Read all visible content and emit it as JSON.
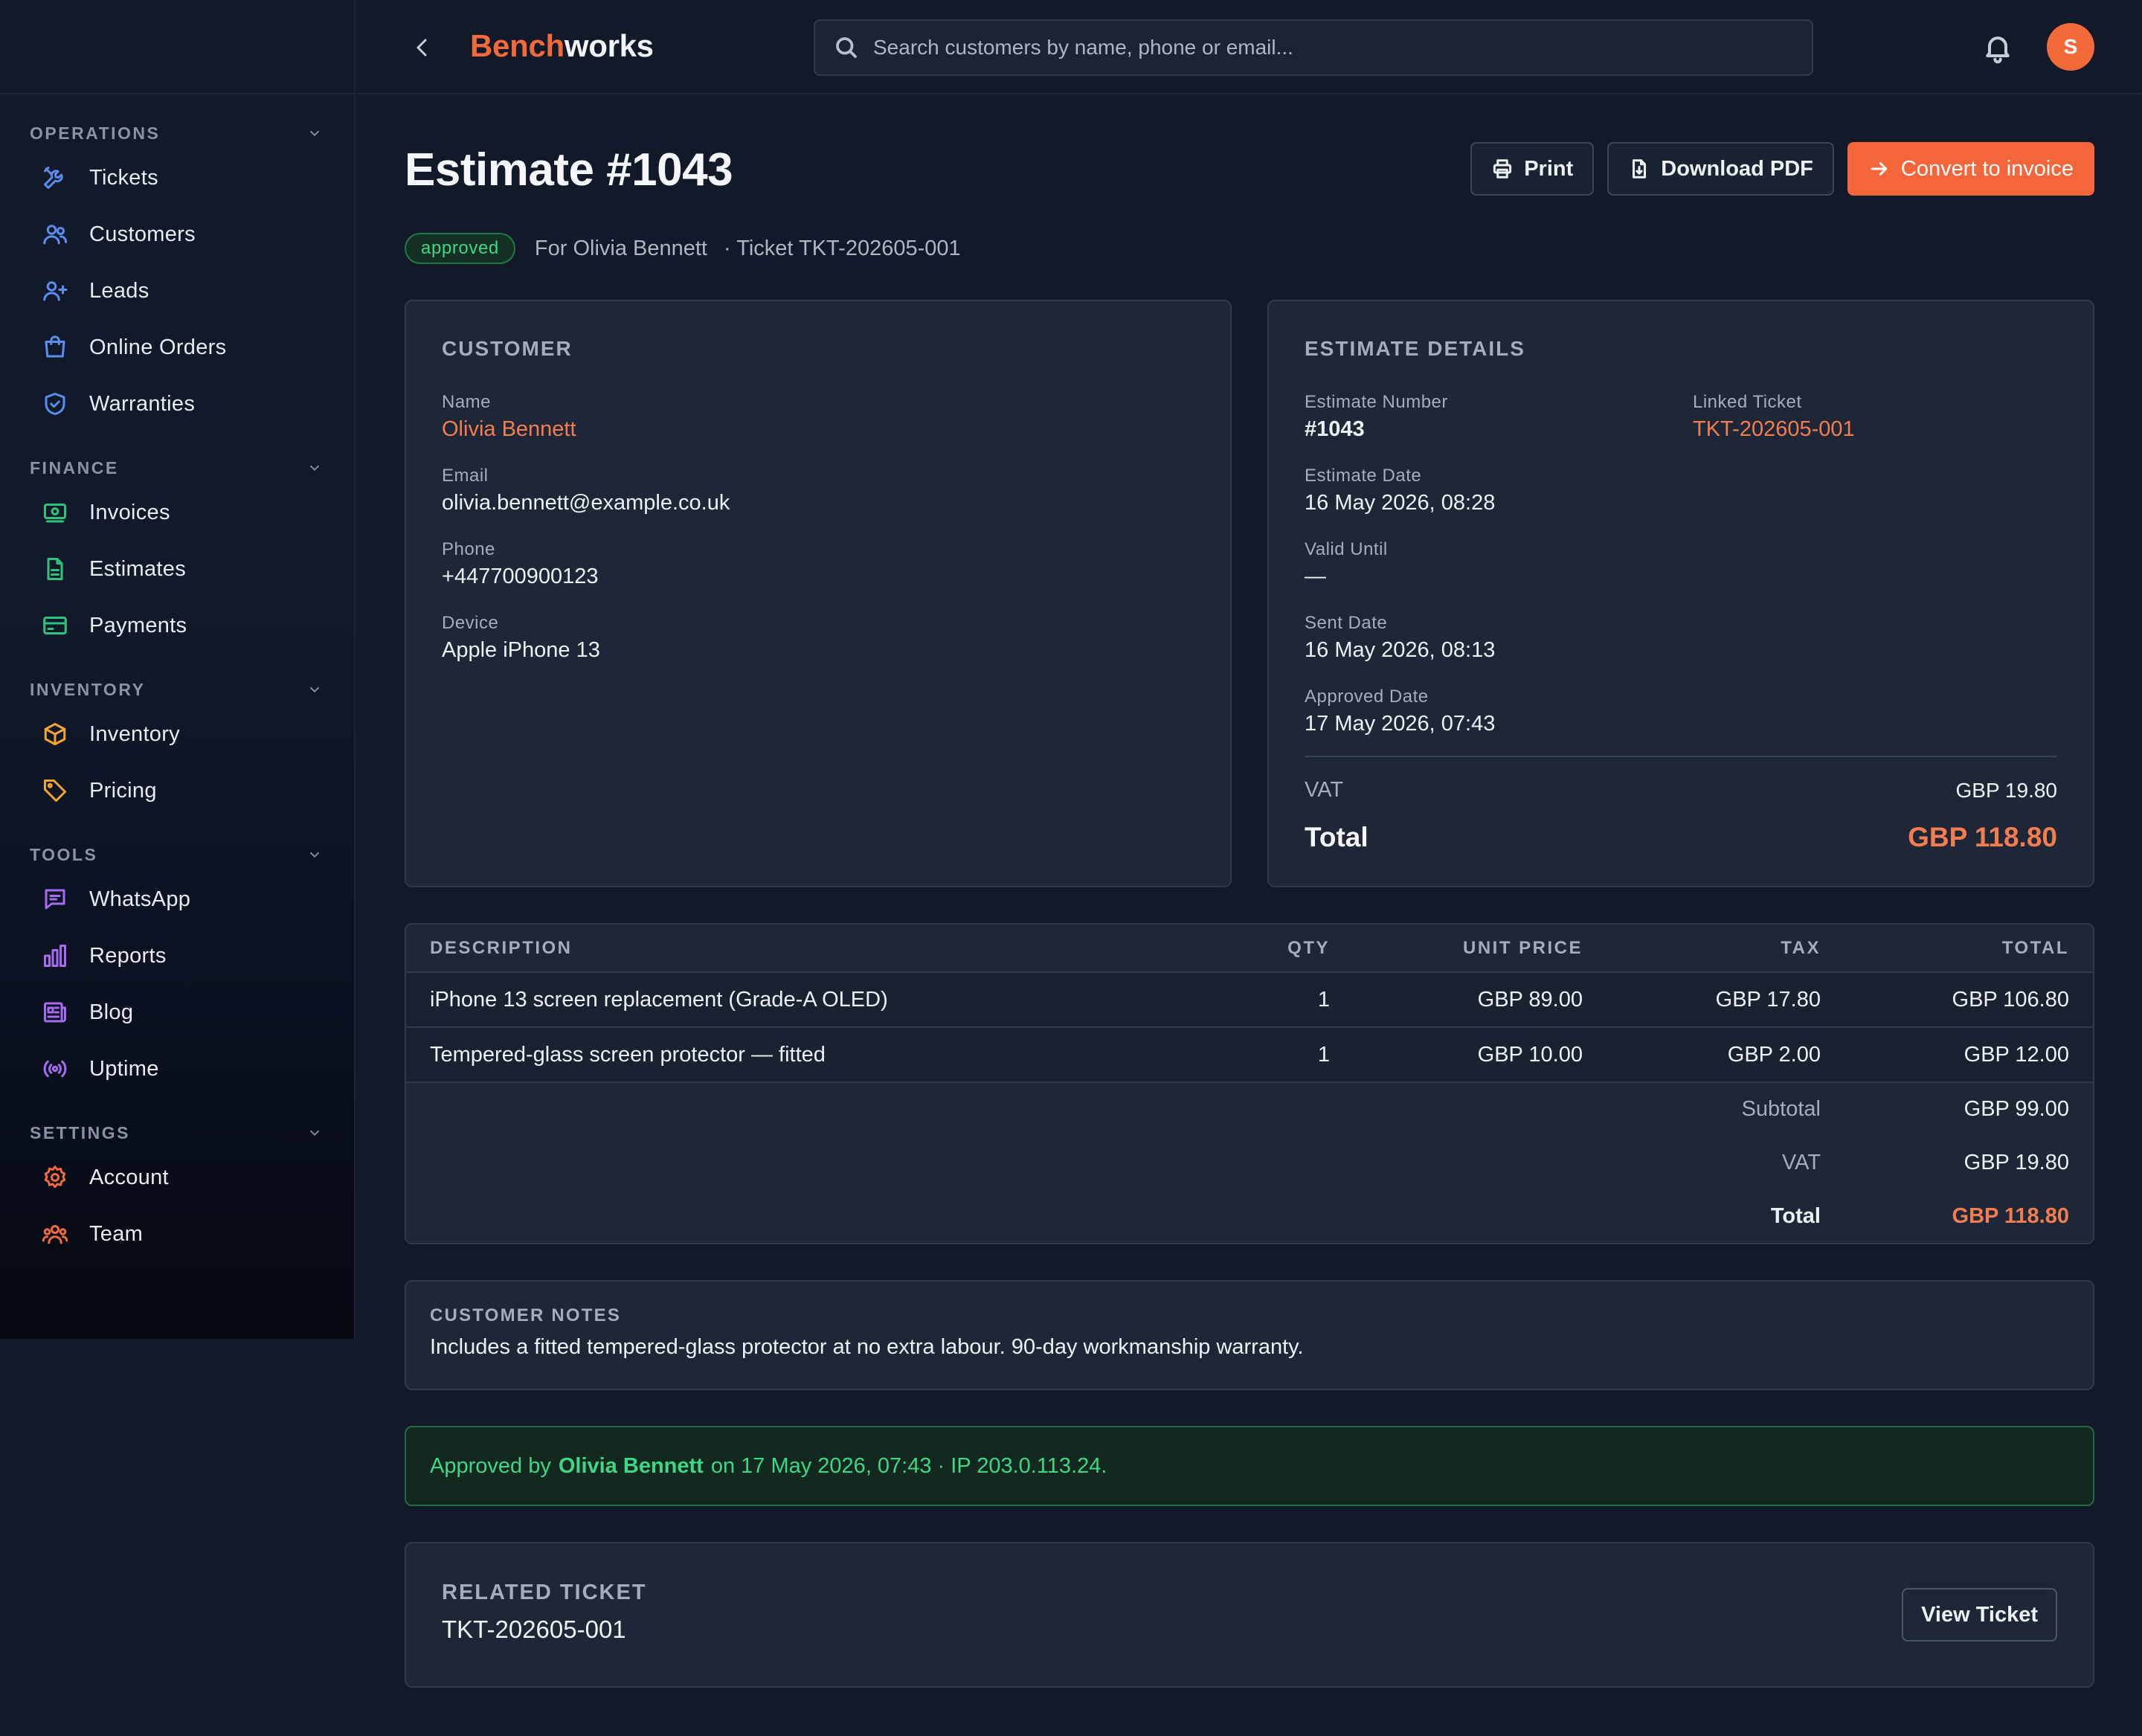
{
  "brand": {
    "part1": "Bench",
    "part2": "works"
  },
  "search": {
    "placeholder": "Search customers by name, phone or email..."
  },
  "user": {
    "initial": "S"
  },
  "sidebar": {
    "sections": [
      {
        "title": "OPERATIONS",
        "items": [
          {
            "label": "Tickets",
            "icon": "tools-icon"
          },
          {
            "label": "Customers",
            "icon": "users-icon"
          },
          {
            "label": "Leads",
            "icon": "user-plus-icon"
          },
          {
            "label": "Online Orders",
            "icon": "shopping-bag-icon"
          },
          {
            "label": "Warranties",
            "icon": "shield-check-icon"
          }
        ]
      },
      {
        "title": "FINANCE",
        "items": [
          {
            "label": "Invoices",
            "icon": "banknote-icon"
          },
          {
            "label": "Estimates",
            "icon": "file-text-icon"
          },
          {
            "label": "Payments",
            "icon": "credit-card-icon"
          }
        ]
      },
      {
        "title": "INVENTORY",
        "items": [
          {
            "label": "Inventory",
            "icon": "box-icon"
          },
          {
            "label": "Pricing",
            "icon": "tag-icon"
          }
        ]
      },
      {
        "title": "TOOLS",
        "items": [
          {
            "label": "WhatsApp",
            "icon": "message-icon"
          },
          {
            "label": "Reports",
            "icon": "bar-chart-icon"
          },
          {
            "label": "Blog",
            "icon": "newspaper-icon"
          },
          {
            "label": "Uptime",
            "icon": "radio-icon"
          }
        ]
      },
      {
        "title": "SETTINGS",
        "items": [
          {
            "label": "Account",
            "icon": "gear-icon"
          },
          {
            "label": "Team",
            "icon": "team-icon"
          }
        ]
      }
    ]
  },
  "page": {
    "title": "Estimate #1043",
    "status": "approved",
    "for_text": "For Olivia Bennett",
    "ticket_text": "· Ticket TKT-202605-001",
    "actions": {
      "print": "Print",
      "download": "Download PDF",
      "convert": "Convert to invoice"
    }
  },
  "customer": {
    "title": "CUSTOMER",
    "name_label": "Name",
    "name": "Olivia Bennett",
    "email_label": "Email",
    "email": "olivia.bennett@example.co.uk",
    "phone_label": "Phone",
    "phone": "+447700900123",
    "device_label": "Device",
    "device": "Apple iPhone 13"
  },
  "details": {
    "title": "ESTIMATE DETAILS",
    "number_label": "Estimate Number",
    "number": "#1043",
    "linked_label": "Linked Ticket",
    "linked": "TKT-202605-001",
    "date_label": "Estimate Date",
    "date": "16 May 2026, 08:28",
    "valid_label": "Valid Until",
    "valid": "—",
    "sent_label": "Sent Date",
    "sent": "16 May 2026, 08:13",
    "approved_label": "Approved Date",
    "approved": "17 May 2026, 07:43",
    "vat_label": "VAT",
    "vat": "GBP 19.80",
    "total_label": "Total",
    "total": "GBP 118.80"
  },
  "items": {
    "headers": {
      "description": "DESCRIPTION",
      "qty": "QTY",
      "unit_price": "UNIT PRICE",
      "tax": "TAX",
      "total": "TOTAL"
    },
    "rows": [
      {
        "description": "iPhone 13 screen replacement (Grade-A OLED)",
        "qty": "1",
        "unit_price": "GBP 89.00",
        "tax": "GBP 17.80",
        "total": "GBP 106.80"
      },
      {
        "description": "Tempered-glass screen protector — fitted",
        "qty": "1",
        "unit_price": "GBP 10.00",
        "tax": "GBP 2.00",
        "total": "GBP 12.00"
      }
    ],
    "subtotal_label": "Subtotal",
    "subtotal": "GBP 99.00",
    "vat_label": "VAT",
    "vat": "GBP 19.80",
    "total_label": "Total",
    "total": "GBP 118.80"
  },
  "notes": {
    "title": "CUSTOMER NOTES",
    "text": "Includes a fitted tempered-glass protector at no extra labour. 90-day workmanship warranty."
  },
  "approval": {
    "prefix": "Approved by",
    "name": "Olivia Bennett",
    "suffix": "on 17 May 2026, 07:43 · IP 203.0.113.24."
  },
  "related": {
    "title": "RELATED TICKET",
    "ticket": "TKT-202605-001",
    "button": "View Ticket"
  },
  "colors": {
    "accent": "#f4653a",
    "success": "#3ed687",
    "background": "#121a2a",
    "card": "#1e2738"
  }
}
